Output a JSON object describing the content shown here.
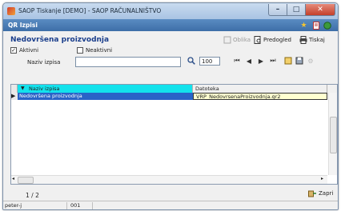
{
  "window": {
    "title": "SAOP Tiskanje [DEMO] - SAOP RAČUNALNIŠTVO"
  },
  "subbar": {
    "title": "QR Izpisi"
  },
  "form": {
    "title": "Nedovršena proizvodnja",
    "toolbar": {
      "oblika_label": "Oblika",
      "predogled_label": "Predogled",
      "tiskaj_label": "Tiskaj"
    },
    "filters": {
      "aktivni_label": "Aktivni",
      "aktivni_checked": true,
      "neaktivni_label": "Neaktivni",
      "neaktivni_checked": false
    },
    "search": {
      "label": "Naziv izpisa",
      "value": ""
    },
    "zoom": "100"
  },
  "grid": {
    "columns": [
      "Naziv izpisa",
      "Datoteka"
    ],
    "rows": [
      {
        "naziv": "Nedovršena proizvodnja",
        "datoteka": "VRP_NedovrsenaProizvodnja.qr2"
      }
    ]
  },
  "footer": {
    "pager": "1 / 2",
    "close_label": "Zapri"
  },
  "statusbar": {
    "user": "peter-j",
    "code": "001"
  }
}
